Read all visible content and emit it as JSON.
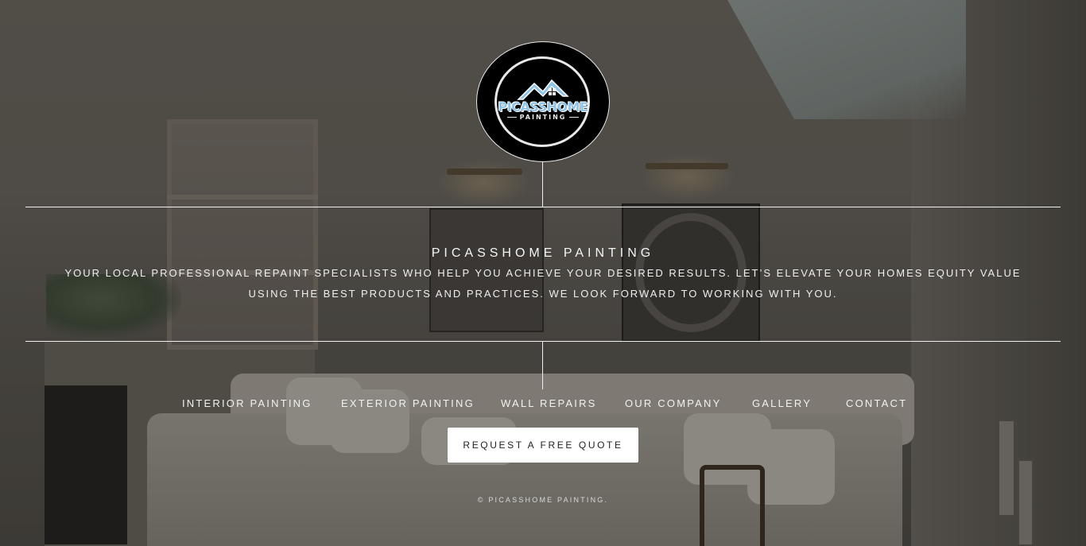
{
  "brand": {
    "logo_title": "PICASSHOME",
    "logo_subtitle": "PAINTING",
    "logo_colors": {
      "accent": "#8fc3e8",
      "background": "#000000",
      "ring": "#e8e8e8"
    }
  },
  "hero": {
    "title": "PICASSHOME PAINTING",
    "tagline": "YOUR LOCAL PROFESSIONAL REPAINT SPECIALISTS WHO HELP YOU ACHIEVE YOUR DESIRED RESULTS. LET’S ELEVATE YOUR HOMES EQUITY VALUE USING THE BEST PRODUCTS AND PRACTICES. WE LOOK FORWARD TO WORKING WITH YOU."
  },
  "nav": {
    "items": [
      {
        "label": "INTERIOR PAINTING"
      },
      {
        "label": "EXTERIOR PAINTING"
      },
      {
        "label": "WALL REPAIRS"
      },
      {
        "label": "OUR COMPANY"
      },
      {
        "label": "GALLERY"
      },
      {
        "label": "CONTACT"
      }
    ]
  },
  "cta": {
    "label": "REQUEST A FREE QUOTE"
  },
  "footer": {
    "copyright": "© PICASSHOME PAINTING."
  },
  "colors": {
    "line": "#f0f0f0",
    "text": "#f2f2f2",
    "button_bg": "#ffffff",
    "button_text": "#222222"
  }
}
